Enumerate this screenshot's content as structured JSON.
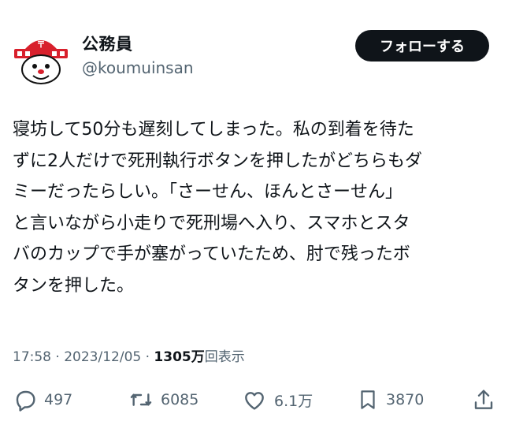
{
  "author": {
    "display_name": "公務員",
    "handle": "@koumuinsan",
    "avatar_icon": "mascot-avatar-icon"
  },
  "follow_button": {
    "label": "フォローする"
  },
  "tweet": {
    "lines": [
      "寝坊して50分も遅刻してしまった。私の到着を待た",
      "ずに2人だけで死刑執行ボタンを押したがどちらもダ",
      "ミーだったらしい。「さーせん、ほんとさーせん」",
      "と言いながら小走りで死刑場へ入り、スマホとスタ",
      "バのカップで手が塞がっていたため、肘で残ったボ",
      "タンを押した。"
    ]
  },
  "meta": {
    "time": "17:58",
    "separator1": " · ",
    "date": "2023/12/05",
    "separator2": " · ",
    "views_count": "1305万",
    "views_label": "回表示"
  },
  "actions": {
    "replies": {
      "icon": "reply-icon",
      "count": "497"
    },
    "reposts": {
      "icon": "repost-icon",
      "count": "6085"
    },
    "likes": {
      "icon": "heart-icon",
      "count": "6.1万"
    },
    "bookmarks": {
      "icon": "bookmark-icon",
      "count": "3870"
    },
    "share": {
      "icon": "share-icon"
    }
  },
  "colors": {
    "text": "#0f1419",
    "secondary": "#536471",
    "avatar_red": "#d8202c"
  }
}
